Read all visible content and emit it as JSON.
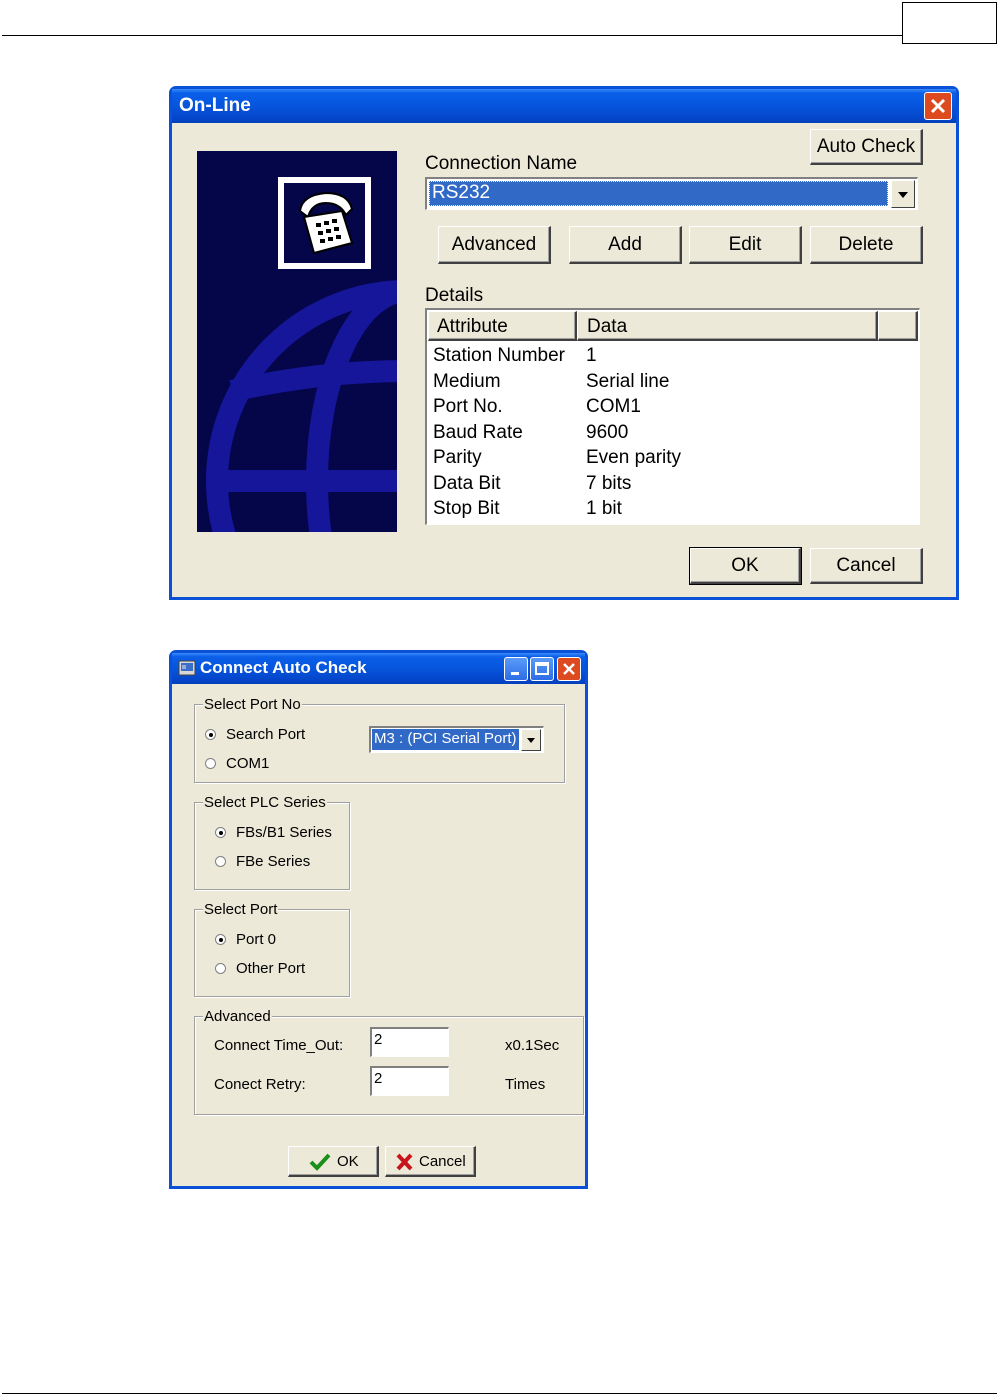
{
  "online_dialog": {
    "title": "On-Line",
    "auto_check_label": "Auto Check",
    "connection_name_label": "Connection Name",
    "connection_name_value": "RS232",
    "buttons": {
      "advanced": "Advanced",
      "add": "Add",
      "edit": "Edit",
      "delete": "Delete",
      "ok": "OK",
      "cancel": "Cancel"
    },
    "details_label": "Details",
    "columns": [
      "Attribute",
      "Data"
    ],
    "rows": [
      [
        "Station Number",
        "1"
      ],
      [
        "Medium",
        "Serial line"
      ],
      [
        "Port No.",
        "COM1"
      ],
      [
        "Baud Rate",
        "9600"
      ],
      [
        "Parity",
        "Even parity"
      ],
      [
        "Data Bit",
        "7 bits"
      ],
      [
        "Stop Bit",
        "1 bit"
      ]
    ]
  },
  "autocheck_dialog": {
    "title": "Connect Auto Check",
    "select_port_no": {
      "title": "Select Port No",
      "search_port": "Search Port",
      "com1": "COM1",
      "combo_value": "M3 : (PCI Serial Port)",
      "selected": "search_port"
    },
    "select_plc_series": {
      "title": "Select PLC Series",
      "option1": "FBs/B1 Series",
      "option2": "FBe Series",
      "selected": "option1"
    },
    "select_port": {
      "title": "Select Port",
      "option1": "Port 0",
      "option2": "Other Port",
      "selected": "option1"
    },
    "advanced": {
      "title": "Advanced",
      "timeout_label": "Connect Time_Out:",
      "timeout_value": "2",
      "timeout_unit": "x0.1Sec",
      "retry_label": "Conect Retry:",
      "retry_value": "2",
      "retry_unit": "Times"
    },
    "ok_label": "OK",
    "cancel_label": "Cancel"
  },
  "icons": [
    "telephone-icon",
    "globe-icon",
    "close-icon",
    "minimize-icon",
    "maximize-icon",
    "app-icon",
    "checkmark-icon",
    "x-icon",
    "dropdown-arrow-icon"
  ]
}
